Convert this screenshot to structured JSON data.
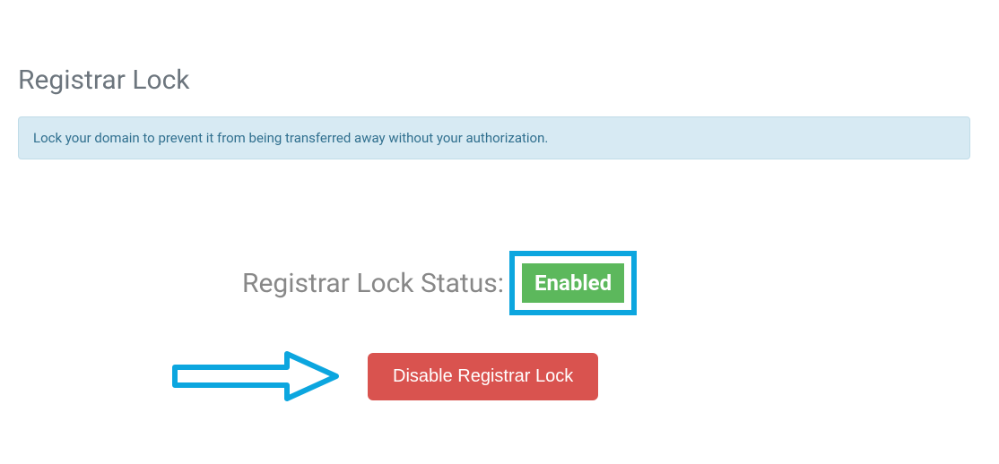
{
  "title": "Registrar Lock",
  "info_text": "Lock your domain to prevent it from being transferred away without your authorization.",
  "status": {
    "label": "Registrar Lock Status:",
    "value": "Enabled"
  },
  "actions": {
    "disable_label": "Disable Registrar Lock"
  },
  "colors": {
    "highlight": "#0ca6df",
    "enabled_badge": "#5cb85c",
    "danger_button": "#d9534f",
    "info_bg": "#d7eaf3"
  }
}
